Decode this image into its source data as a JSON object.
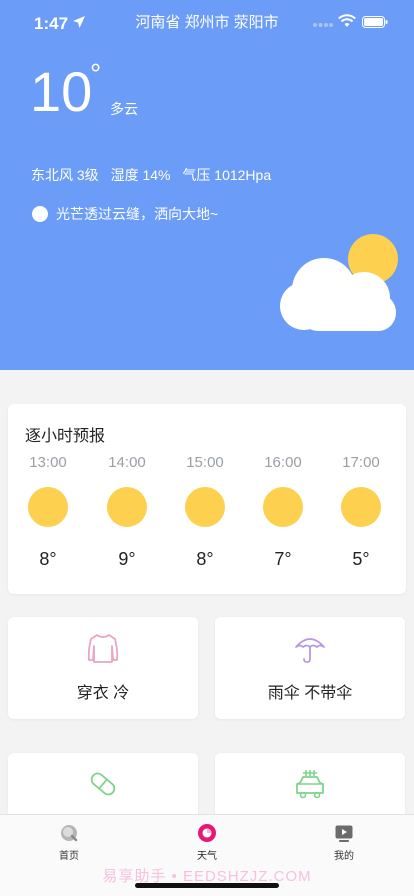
{
  "status": {
    "time": "1:47",
    "location": "河南省 郑州市 荥阳市"
  },
  "weather": {
    "temperature": "10",
    "degree_symbol": "°",
    "condition": "多云",
    "wind": "东北风 3级",
    "humidity": "湿度 14%",
    "pressure": "气压 1012Hpa",
    "tip": "光芒透过云缝，洒向大地~"
  },
  "hourly": {
    "title": "逐小时预报",
    "items": [
      {
        "time": "13:00",
        "temp": "8°"
      },
      {
        "time": "14:00",
        "temp": "9°"
      },
      {
        "time": "15:00",
        "temp": "8°"
      },
      {
        "time": "16:00",
        "temp": "7°"
      },
      {
        "time": "17:00",
        "temp": "5°"
      }
    ]
  },
  "suggestions": [
    {
      "label": "穿衣 冷",
      "icon": "clothes-icon"
    },
    {
      "label": "雨伞 不带伞",
      "icon": "umbrella-icon"
    },
    {
      "label": "",
      "icon": "pill-icon"
    },
    {
      "label": "",
      "icon": "car-wash-icon"
    }
  ],
  "tabbar": [
    {
      "label": "首页",
      "icon": "home-icon"
    },
    {
      "label": "天气",
      "icon": "weather-icon",
      "active": true
    },
    {
      "label": "我的",
      "icon": "profile-icon"
    }
  ],
  "watermark": "易享助手 • EEDSHZJZ.COM",
  "colors": {
    "hero": "#6b9cf7",
    "sun": "#fdd04f",
    "clothes": "#e8a6c4",
    "umbrella": "#b79ae0",
    "green": "#7fd48c",
    "active_tab": "#e6177a"
  }
}
